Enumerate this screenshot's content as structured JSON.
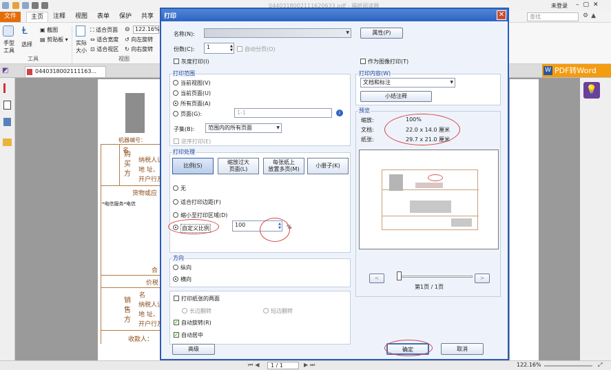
{
  "window": {
    "title": "04403180021116206​33.pdf - 福昕阅读器",
    "user": "未登录",
    "search_placeholder": "查找"
  },
  "ribbon": {
    "tabs": [
      "文件",
      "主页",
      "注释",
      "视图",
      "表单",
      "保护",
      "共享"
    ],
    "hand_tool": "手型工具",
    "select_tool": "选择",
    "snapshot": "截图",
    "clipboard": "剪贴板",
    "actual_size": "实际大小",
    "fit_page": "适合页面",
    "fit_width": "适合宽度",
    "fit_visible": "适合视区",
    "zoom": "122.16%",
    "rotate_left": "向左旋转",
    "rotate_right": "向右旋转",
    "group_tools": "工具",
    "group_view": "视图"
  },
  "doc_tab": {
    "label": "0440318002111163..."
  },
  "pdf_to_word": "PDF转Word",
  "page_text": {
    "machine_no": "机器编号：",
    "buyer": "购\n买\n方",
    "name": "名",
    "taxpayer": "纳税人识",
    "address": "地  址、",
    "bank": "开户行及",
    "goods": "货物或应",
    "service": "*电信服务*电信",
    "total": "合",
    "tax_total": "价税",
    "seller": "销\n售\n方",
    "s_name": "名",
    "s_taxpayer": "纳税人识",
    "s_address": "地  址、",
    "s_bank": "开户行及",
    "payee": "收款人："
  },
  "dialog": {
    "title": "打印",
    "printer_label": "名称(N):",
    "properties_button": "属性(P)",
    "copies_label": "份数(C):",
    "copies_value": "1",
    "collate": "自动分页(O)",
    "grayscale": "灰度打印(I)",
    "print_as_image": "作为图像打印(T)",
    "range": {
      "legend": "打印范围",
      "current_view": "当前视图(V)",
      "current_page": "当前页面(U)",
      "all_pages": "所有页面(A)",
      "pages": "页面(G):",
      "pages_placeholder": "1-1",
      "subset_label": "子集(B):",
      "subset_value": "范围内的所有页面",
      "reverse": "逆序打印(E)"
    },
    "content": {
      "legend": "打印内容(W)",
      "value": "文档和标注",
      "summarize_button": "小结注释"
    },
    "preview": {
      "legend": "预览",
      "zoom_label": "缩放:",
      "zoom_value": "100%",
      "doc_label": "文档:",
      "doc_value": "22.0 x 14.0 厘米",
      "paper_label": "纸张:",
      "paper_value": "29.7 x 21.0 厘米",
      "page_indicator": "第1页 / 1页",
      "prev": "<",
      "next": ">"
    },
    "handling": {
      "legend": "打印处理",
      "scale": "比例(S)",
      "fit_large": "缩放过大\n页面(L)",
      "multiple": "每张纸上\n放置多页(M)",
      "booklet": "小册子(K)",
      "none": "无",
      "fit_margins": "适合打印边距(F)",
      "shrink": "缩小至打印区域(D)",
      "custom": "自定义比例",
      "custom_value": "100",
      "percent": "%"
    },
    "orientation": {
      "legend": "方向",
      "portrait": "纵向",
      "landscape": "横向"
    },
    "duplex": {
      "both_sides": "打印纸张的两面",
      "long_edge": "长边翻转",
      "short_edge": "短边翻转",
      "auto_rotate": "自动旋转(R)",
      "auto_center": "自动居中"
    },
    "advanced_button": "高级",
    "ok_button": "确定",
    "cancel_button": "取消"
  },
  "status": {
    "page": "1 / 1",
    "zoom": "122.16%"
  }
}
